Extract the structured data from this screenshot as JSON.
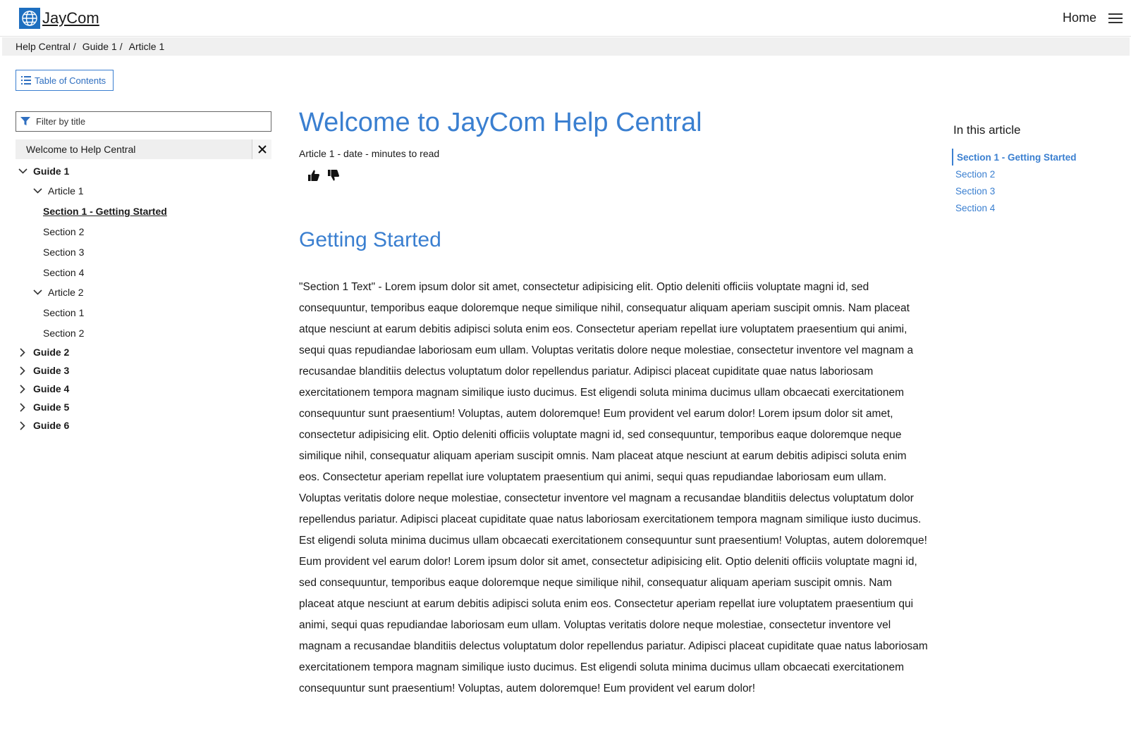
{
  "header": {
    "brand": "JayCom",
    "home_label": "Home"
  },
  "breadcrumb": [
    "Help Central",
    "Guide 1",
    "Article 1"
  ],
  "toc_button": "Table of Contents",
  "filter": {
    "placeholder": "Filter by title"
  },
  "sidebar": {
    "welcome": "Welcome to Help Central",
    "guide1": "Guide 1",
    "article1": "Article 1",
    "a1_sections": [
      "Section 1 - Getting Started",
      "Section 2",
      "Section 3",
      "Section 4"
    ],
    "article2": "Article 2",
    "a2_sections": [
      "Section 1",
      "Section 2"
    ],
    "guides": [
      "Guide 2",
      "Guide 3",
      "Guide 4",
      "Guide 5",
      "Guide 6"
    ]
  },
  "main": {
    "title": "Welcome to JayCom Help Central",
    "meta": "Article 1 - date - minutes to read",
    "section_heading": "Getting Started",
    "body": "\"Section 1 Text\" - Lorem ipsum dolor sit amet, consectetur adipisicing elit. Optio deleniti officiis voluptate magni id, sed consequuntur, temporibus eaque doloremque neque similique nihil, consequatur aliquam aperiam suscipit omnis. Nam placeat atque nesciunt at earum debitis adipisci soluta enim eos. Consectetur aperiam repellat iure voluptatem praesentium qui animi, sequi quas repudiandae laboriosam eum ullam. Voluptas veritatis dolore neque molestiae, consectetur inventore vel magnam a recusandae blanditiis delectus voluptatum dolor repellendus pariatur. Adipisci placeat cupiditate quae natus laboriosam exercitationem tempora magnam similique iusto ducimus. Est eligendi soluta minima ducimus ullam obcaecati exercitationem consequuntur sunt praesentium! Voluptas, autem doloremque! Eum provident vel earum dolor! Lorem ipsum dolor sit amet, consectetur adipisicing elit. Optio deleniti officiis voluptate magni id, sed consequuntur, temporibus eaque doloremque neque similique nihil, consequatur aliquam aperiam suscipit omnis. Nam placeat atque nesciunt at earum debitis adipisci soluta enim eos. Consectetur aperiam repellat iure voluptatem praesentium qui animi, sequi quas repudiandae laboriosam eum ullam. Voluptas veritatis dolore neque molestiae, consectetur inventore vel magnam a recusandae blanditiis delectus voluptatum dolor repellendus pariatur. Adipisci placeat cupiditate quae natus laboriosam exercitationem tempora magnam similique iusto ducimus. Est eligendi soluta minima ducimus ullam obcaecati exercitationem consequuntur sunt praesentium! Voluptas, autem doloremque! Eum provident vel earum dolor! Lorem ipsum dolor sit amet, consectetur adipisicing elit. Optio deleniti officiis voluptate magni id, sed consequuntur, temporibus eaque doloremque neque similique nihil, consequatur aliquam aperiam suscipit omnis. Nam placeat atque nesciunt at earum debitis adipisci soluta enim eos. Consectetur aperiam repellat iure voluptatem praesentium qui animi, sequi quas repudiandae laboriosam eum ullam. Voluptas veritatis dolore neque molestiae, consectetur inventore vel magnam a recusandae blanditiis delectus voluptatum dolor repellendus pariatur. Adipisci placeat cupiditate quae natus laboriosam exercitationem tempora magnam similique iusto ducimus. Est eligendi soluta minima ducimus ullam obcaecati exercitationem consequuntur sunt praesentium! Voluptas, autem doloremque! Eum provident vel earum dolor!"
  },
  "in_this_article": {
    "title": "In this article",
    "items": [
      "Section 1 - Getting Started",
      "Section 2",
      "Section 3",
      "Section 4"
    ]
  },
  "colors": {
    "accent": "#3a7fd0",
    "logo": "#1e6fc0",
    "breadcrumb_bg": "#f0f0f0"
  }
}
